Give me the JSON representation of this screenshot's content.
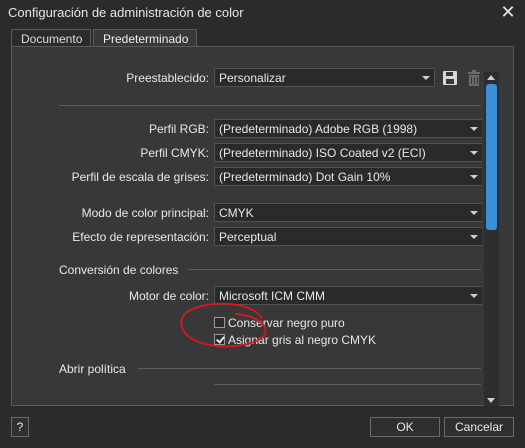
{
  "window": {
    "title": "Configuración de administración de color"
  },
  "tabs": [
    {
      "label": "Documento"
    },
    {
      "label": "Predeterminado"
    }
  ],
  "preset": {
    "label": "Preestablecido:",
    "value": "Personalizar"
  },
  "profiles": {
    "rgb": {
      "label": "Perfil RGB:",
      "value": "(Predeterminado) Adobe RGB (1998)"
    },
    "cmyk": {
      "label": "Perfil CMYK:",
      "value": "(Predeterminado) ISO Coated v2 (ECI)"
    },
    "gray": {
      "label": "Perfil de escala de grises:",
      "value": "(Predeterminado) Dot Gain 10%"
    }
  },
  "mode": {
    "label": "Modo de color principal:",
    "value": "CMYK"
  },
  "intent": {
    "label": "Efecto de representación:",
    "value": "Perceptual"
  },
  "conversion": {
    "heading": "Conversión de colores",
    "engine_label": "Motor de color:",
    "engine_value": "Microsoft ICM CMM",
    "preserve_black": {
      "label": "Conservar negro puro",
      "checked": false
    },
    "assign_gray": {
      "label": "Asignar gris al negro CMYK",
      "checked": true
    }
  },
  "policy": {
    "heading": "Abrir política"
  },
  "footer": {
    "help": "?",
    "ok": "OK",
    "cancel": "Cancelar"
  },
  "colors": {
    "accent": "#3b8ed8",
    "annotation": "#e0141e",
    "background": "#383838"
  }
}
